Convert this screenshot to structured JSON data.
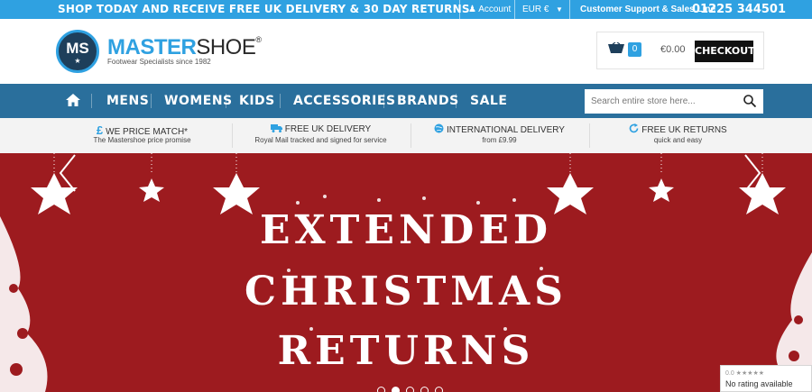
{
  "topbar": {
    "promo": "SHOP TODAY AND RECEIVE FREE UK DELIVERY & 30 DAY RETURNS",
    "account_label": "Account",
    "currency": "EUR €",
    "support_label": "Customer Support & Sales Line",
    "phone": "01225 344501"
  },
  "header": {
    "logo_initials": "MS",
    "brand_part1": "MASTER",
    "brand_part2": "SHOE",
    "registered": "®",
    "tagline": "Footwear Specialists since 1982",
    "cart": {
      "count": "0",
      "total": "€0.00",
      "checkout_label": "CHECKOUT"
    }
  },
  "nav": {
    "items": [
      "MENS",
      "WOMENS",
      "KIDS",
      "ACCESSORIES",
      "BRANDS",
      "SALE"
    ],
    "search_placeholder": "Search entire store here..."
  },
  "features": [
    {
      "icon": "£",
      "title": "WE PRICE MATCH*",
      "subtitle": "The Mastershoe price promise"
    },
    {
      "icon": "truck",
      "title": "FREE UK DELIVERY",
      "subtitle": "Royal Mail tracked and signed for service"
    },
    {
      "icon": "globe",
      "title": "INTERNATIONAL DELIVERY",
      "subtitle": "from £9.99"
    },
    {
      "icon": "refresh",
      "title": "FREE UK RETURNS",
      "subtitle": "quick and easy"
    }
  ],
  "banner": {
    "line1": "EXTENDED",
    "line2": "CHRISTMAS",
    "line3": "RETURNS",
    "background": "#9d1b1f",
    "slides": 5,
    "active_slide": 2
  },
  "rating_widget": {
    "score": "0.0 ★★★★★",
    "text": "No rating available"
  },
  "colors": {
    "accent": "#2fa1e1",
    "nav": "#2a6f9c",
    "checkout": "#111111"
  }
}
